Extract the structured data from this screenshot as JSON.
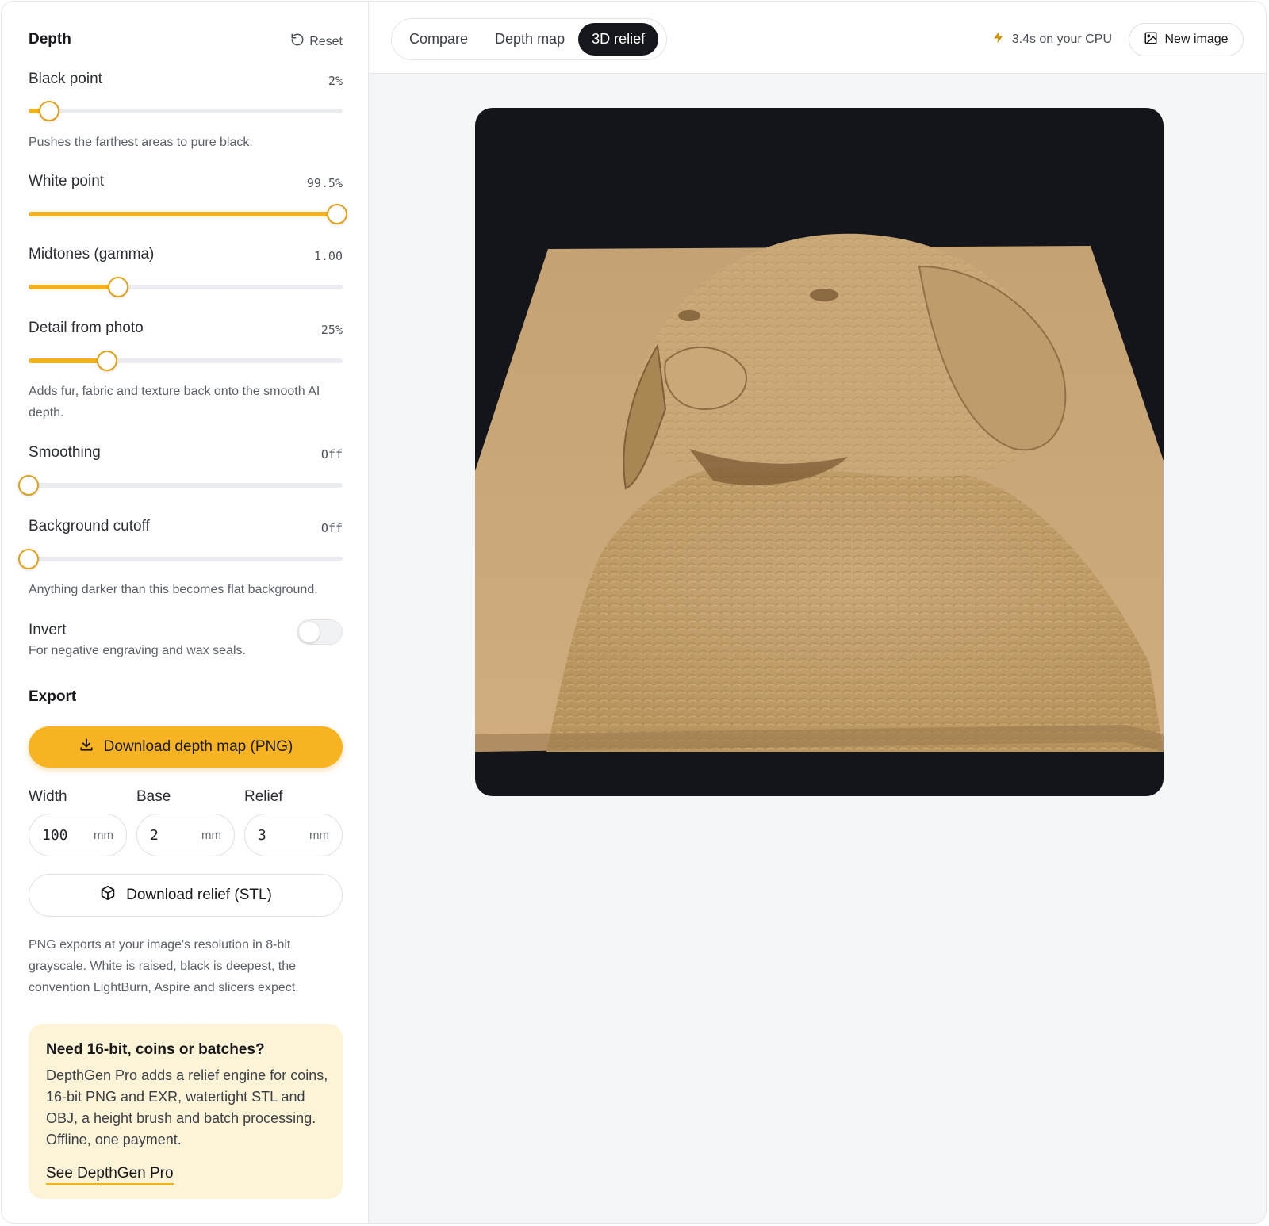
{
  "sidebar": {
    "depth_title": "Depth",
    "reset_label": "Reset",
    "sliders": [
      {
        "label": "Black point",
        "value": "2%",
        "level": 0.065,
        "hint": "Pushes the farthest areas to pure black."
      },
      {
        "label": "White point",
        "value": "99.5%",
        "level": 0.983
      },
      {
        "label": "Midtones (gamma)",
        "value": "1.00",
        "level": 0.285
      },
      {
        "label": "Detail from photo",
        "value": "25%",
        "level": 0.25,
        "hint": "Adds fur, fabric and texture back onto the smooth AI depth."
      },
      {
        "label": "Smoothing",
        "value": "Off",
        "level": 0
      },
      {
        "label": "Background cutoff",
        "value": "Off",
        "level": 0,
        "hint": "Anything darker than this becomes flat background."
      }
    ],
    "invert": {
      "label": "Invert",
      "hint": "For negative engraving and wax seals.",
      "on": false
    },
    "export_title": "Export",
    "download_png_label": "Download depth map (PNG)",
    "fields": {
      "width": {
        "label": "Width",
        "value": "100",
        "unit": "mm"
      },
      "base": {
        "label": "Base",
        "value": "2",
        "unit": "mm"
      },
      "relief": {
        "label": "Relief",
        "value": "3",
        "unit": "mm"
      }
    },
    "download_stl_label": "Download relief (STL)",
    "export_note": "PNG exports at your image's resolution in 8-bit grayscale. White is raised, black is deepest, the convention LightBurn, Aspire and slicers expect.",
    "promo": {
      "title": "Need 16-bit, coins or batches?",
      "body": "DepthGen Pro adds a relief engine for coins, 16-bit PNG and EXR, watertight STL and OBJ, a height brush and batch processing. Offline, one payment.",
      "link": "See DepthGen Pro"
    }
  },
  "header": {
    "tabs": [
      "Compare",
      "Depth map",
      "3D relief"
    ],
    "active_tab": "3D relief",
    "perf": "3.4s on your CPU",
    "new_image_label": "New image"
  },
  "colors": {
    "accent": "#f2b21f",
    "relief": "#c9a77a",
    "viewport_bg": "#13151b"
  },
  "icons": {
    "reset": "rotate-ccw-icon",
    "perf": "bolt-icon",
    "new_image": "image-icon",
    "download": "download-icon",
    "stl": "cube-icon"
  }
}
